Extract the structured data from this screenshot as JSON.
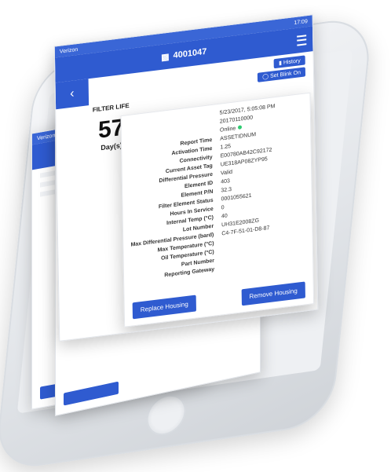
{
  "status": {
    "carrier": "Verizon",
    "time": "17:09"
  },
  "header": {
    "device_id": "4001047"
  },
  "top_actions": {
    "history": "History",
    "blink": "Set Blink On"
  },
  "filter_life": {
    "label": "FILTER LIFE",
    "value": "57",
    "unit": "Day(s)"
  },
  "info_top": [
    {
      "value": "5/23/2017, 5:05:08 PM"
    },
    {
      "value": "20170110000"
    },
    {
      "value": "Online"
    }
  ],
  "rows": [
    {
      "label": "Report Time",
      "value": "ASSETIDNUM"
    },
    {
      "label": "Activation Time",
      "value": "1.25"
    },
    {
      "label": "Connectivity",
      "value": "E00780AB42C92172"
    },
    {
      "label": "Current Asset Tag",
      "value": "UE318AP08ZYP95"
    },
    {
      "label": "Differential Pressure",
      "value": "Valid"
    },
    {
      "label": "Element ID",
      "value": "403"
    },
    {
      "label": "Element P/N",
      "value": "32.3"
    },
    {
      "label": "Filter Element Status",
      "value": "0001055621"
    },
    {
      "label": "Hours In Service",
      "value": "0"
    },
    {
      "label": "Internal Temp (°C)",
      "value": "40"
    },
    {
      "label": "Lot Number",
      "value": "UH31E2008ZG"
    },
    {
      "label": "Max Differential Pressure (bard)",
      "value": "C4-7F-51-01-D8-87"
    },
    {
      "label": "Max Temperature (°C)",
      "value": ""
    },
    {
      "label": "Oil Temperature (°C)",
      "value": ""
    },
    {
      "label": "Part Number",
      "value": ""
    },
    {
      "label": "Reporting Gateway",
      "value": ""
    }
  ],
  "buttons": {
    "replace": "Replace Housing",
    "remove": "Remove Housing"
  },
  "colors": {
    "accent": "#2f5bd0",
    "online": "#2ecc71"
  }
}
